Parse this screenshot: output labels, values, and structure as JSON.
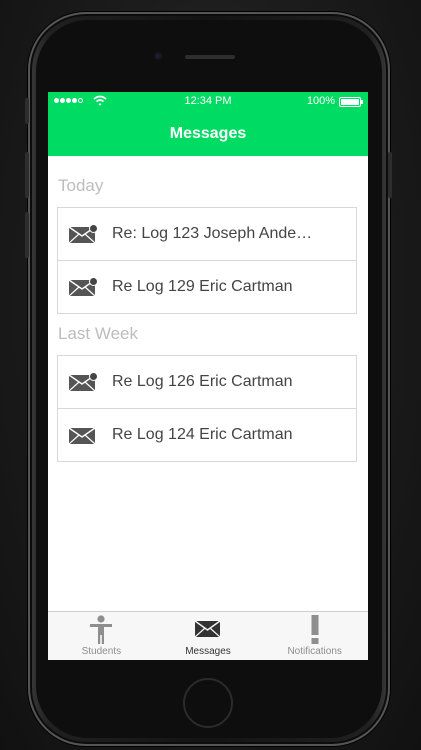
{
  "status_bar": {
    "carrier_signal": "●●●●○",
    "time": "12:34 PM",
    "battery": "100%"
  },
  "nav": {
    "title": "Messages"
  },
  "sections": [
    {
      "header": "Today",
      "items": [
        {
          "label": "Re: Log 123 Joseph Ande…",
          "unread": true
        },
        {
          "label": "Re Log 129 Eric Cartman",
          "unread": true
        }
      ]
    },
    {
      "header": "Last Week",
      "items": [
        {
          "label": "Re Log 126 Eric Cartman",
          "unread": true
        },
        {
          "label": "Re Log 124 Eric Cartman",
          "unread": false
        }
      ]
    }
  ],
  "tabs": [
    {
      "label": "Students",
      "icon": "person-icon",
      "active": false
    },
    {
      "label": "Messages",
      "icon": "envelope-icon",
      "active": true
    },
    {
      "label": "Notifications",
      "icon": "exclamation-icon",
      "active": false
    }
  ],
  "colors": {
    "accent": "#00dc63",
    "section_header": "#bdbdbd",
    "text": "#444444"
  }
}
